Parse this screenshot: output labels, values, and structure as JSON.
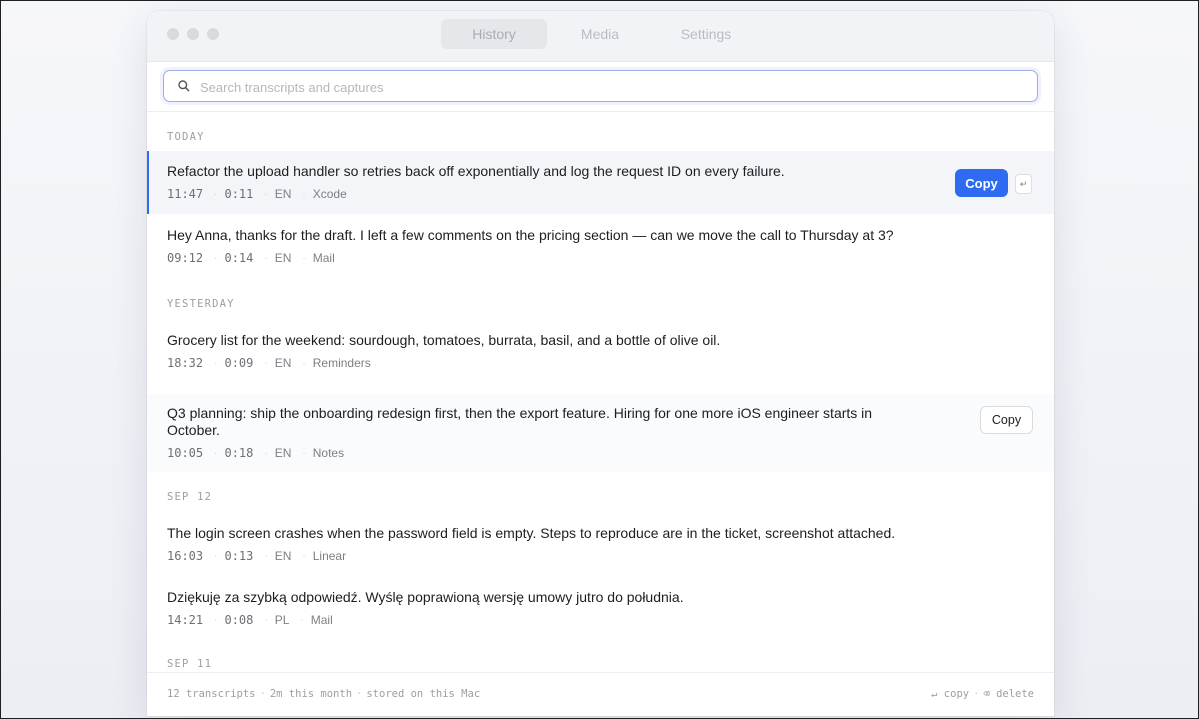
{
  "tabs": [
    {
      "label": "History",
      "active": true
    },
    {
      "label": "Media",
      "active": false
    },
    {
      "label": "Settings",
      "active": false
    }
  ],
  "search": {
    "placeholder": "Search transcripts and captures",
    "value": ""
  },
  "sections": {
    "today": "TODAY",
    "yesterday": "YESTERDAY",
    "sep12": "SEP 12",
    "sep11": "SEP 11"
  },
  "entries": [
    {
      "text": "Refactor the upload handler so retries back off exponentially and log the request ID on every failure.",
      "time": "11:47",
      "duration": "0:11",
      "lang": "EN",
      "app": "Xcode"
    },
    {
      "text": "Hey Anna, thanks for the draft. I left a few comments on the pricing section — can we move the call to Thursday at 3?",
      "time": "09:12",
      "duration": "0:14",
      "lang": "EN",
      "app": "Mail"
    },
    {
      "text": "Grocery list for the weekend: sourdough, tomatoes, burrata, basil, and a bottle of olive oil.",
      "time": "18:32",
      "duration": "0:09",
      "lang": "EN",
      "app": "Reminders"
    },
    {
      "text": "Q3 planning: ship the onboarding redesign first, then the export feature. Hiring for one more iOS engineer starts in October.",
      "time": "10:05",
      "duration": "0:18",
      "lang": "EN",
      "app": "Notes"
    },
    {
      "text": "The login screen crashes when the password field is empty. Steps to reproduce are in the ticket, screenshot attached.",
      "time": "16:03",
      "duration": "0:13",
      "lang": "EN",
      "app": "Linear"
    },
    {
      "text": "Dziękuję za szybką odpowiedź. Wyślę poprawioną wersję umowy jutro do południa.",
      "time": "14:21",
      "duration": "0:08",
      "lang": "PL",
      "app": "Mail"
    }
  ],
  "buttons": {
    "copy": "Copy",
    "enter_key": "↵"
  },
  "footer": {
    "count": "12 transcripts",
    "month": "2m this month",
    "stored": "stored on this Mac",
    "copy_hint": "↵ copy",
    "delete_hint": "⌫ delete"
  },
  "colors": {
    "accent": "#2f6bf0"
  }
}
